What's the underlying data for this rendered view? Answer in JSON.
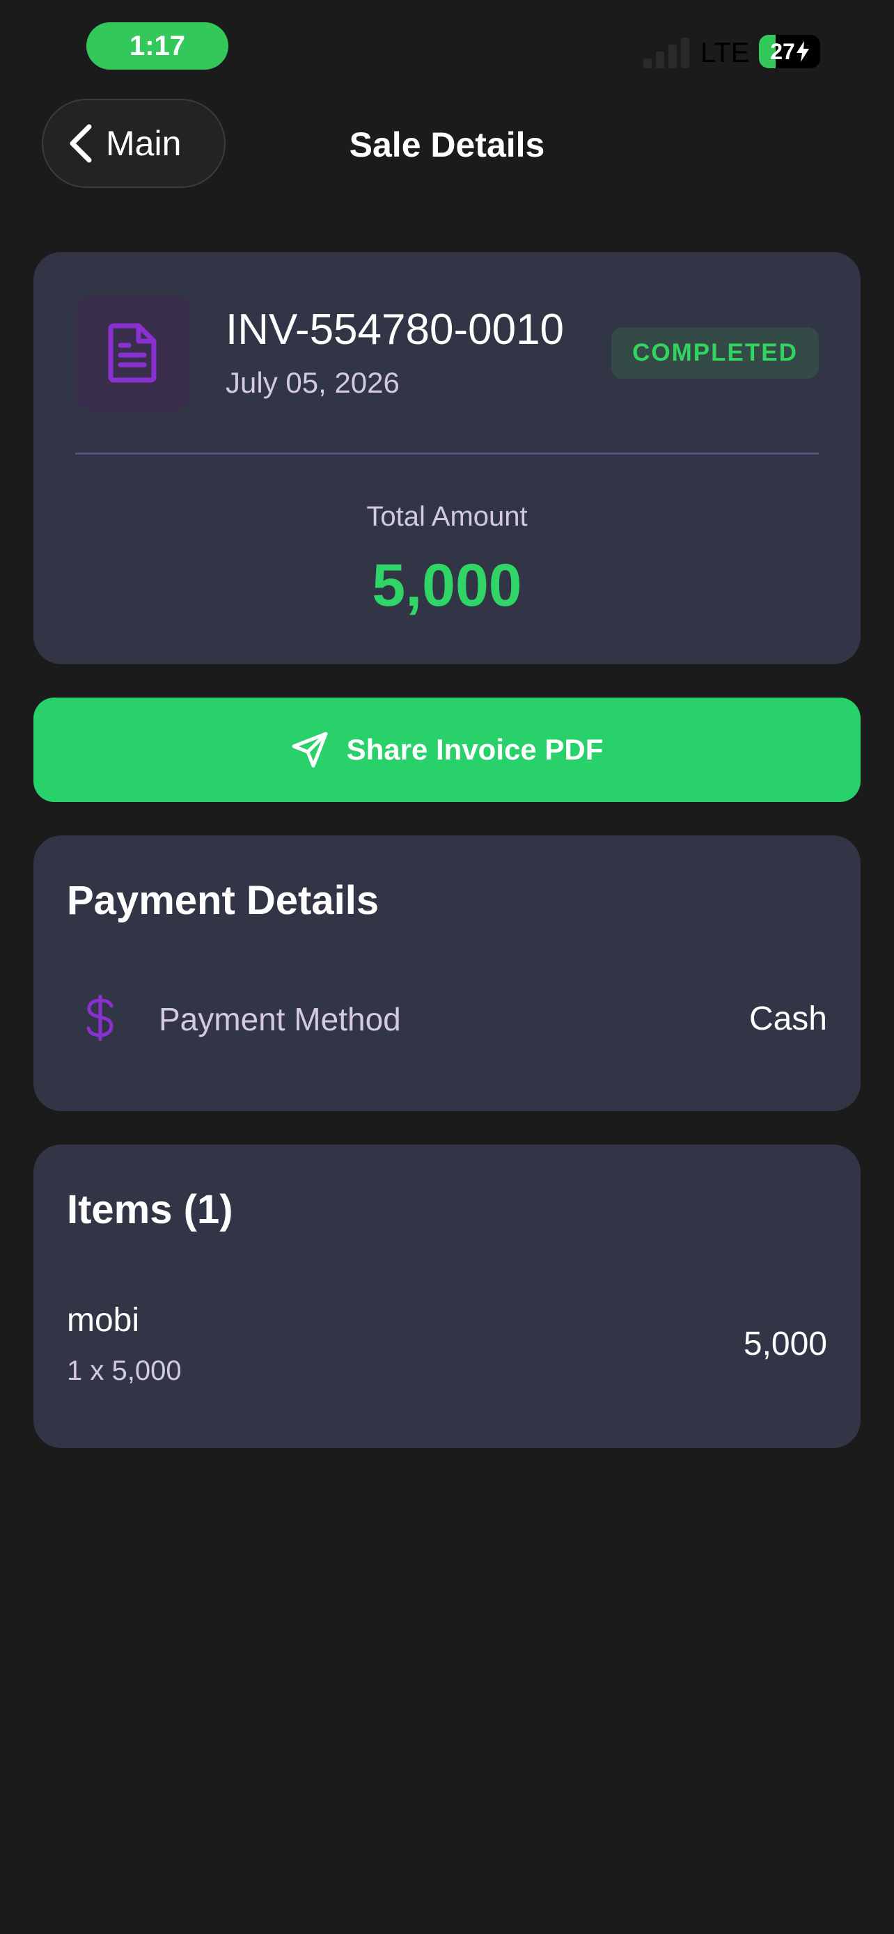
{
  "status_bar": {
    "time": "1:17",
    "network": "LTE",
    "battery_level": "27",
    "battery_fraction": 0.27
  },
  "nav": {
    "back_label": "Main",
    "title": "Sale Details"
  },
  "invoice": {
    "number": "INV-554780-0010",
    "date": "July 05, 2026",
    "status": "COMPLETED",
    "total_label": "Total Amount",
    "total_value": "5,000"
  },
  "share_button": {
    "label": "Share Invoice PDF"
  },
  "payment": {
    "title": "Payment Details",
    "method_label": "Payment Method",
    "method_value": "Cash"
  },
  "items": {
    "title": "Items (1)",
    "list": [
      {
        "name": "mobi",
        "qty_price": "1 x 5,000",
        "total": "5,000"
      }
    ]
  },
  "colors": {
    "background": "#1b1b1c",
    "card": "#313545",
    "accent_green": "#28d16a",
    "accent_purple": "#8a2fd0",
    "muted_text": "#d4c8e6"
  },
  "icons": {
    "back": "chevron-left-icon",
    "document": "document-icon",
    "share": "send-icon",
    "payment": "dollar-icon",
    "battery": "battery-charging-icon",
    "signal": "cellular-signal-icon"
  }
}
